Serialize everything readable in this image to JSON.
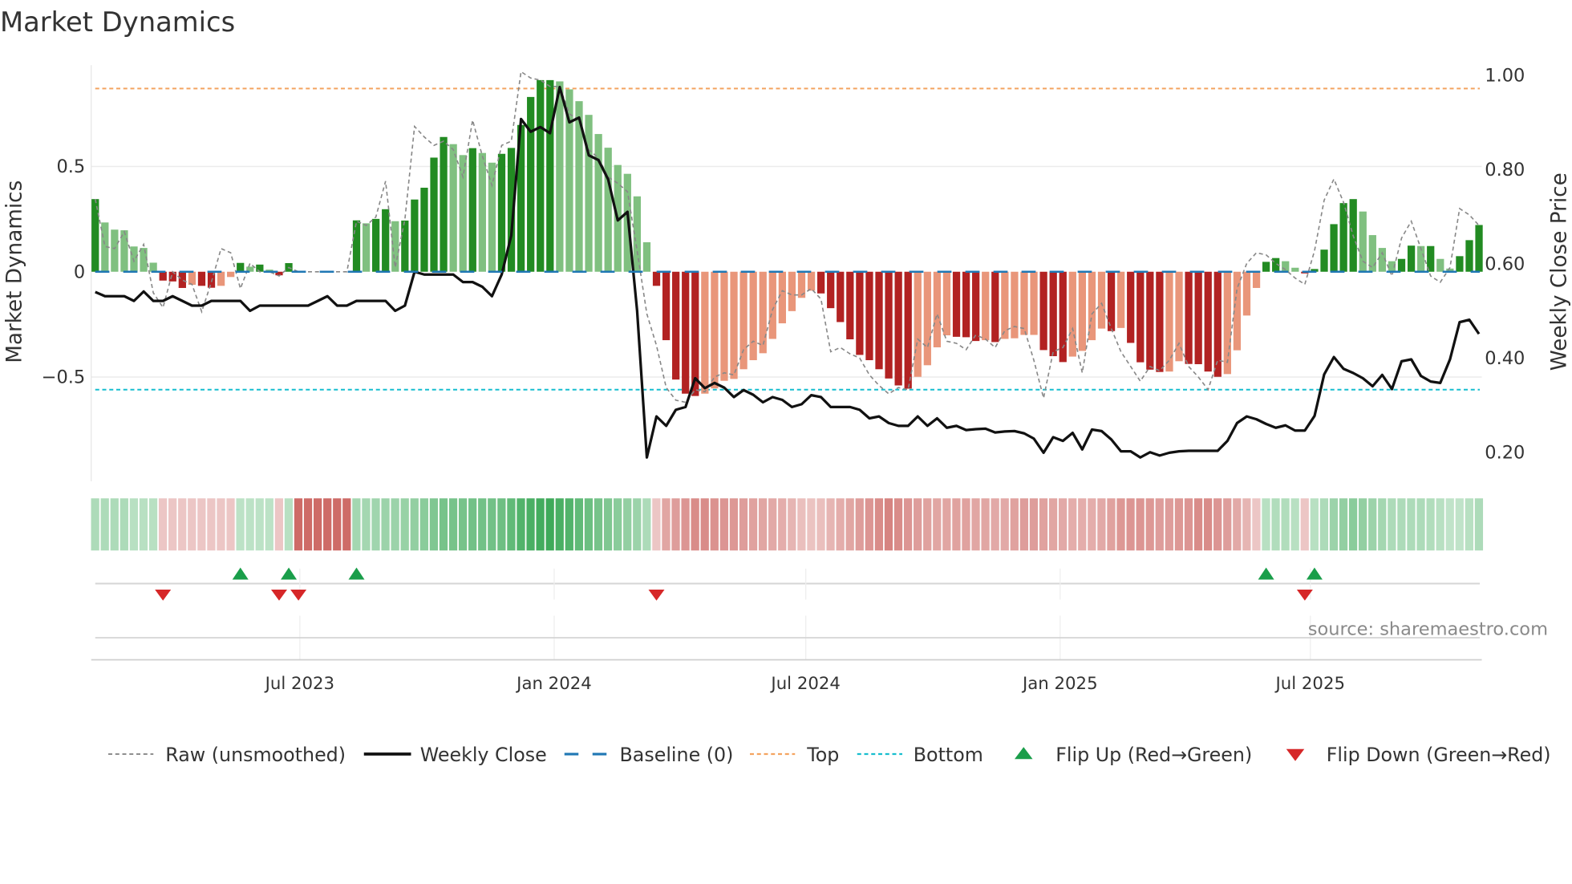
{
  "chart_data": {
    "type": "bar",
    "title": "Market Dynamics",
    "ylabel": "Market Dynamics",
    "y2label": "Weekly Close Price",
    "source": "source: sharemaestro.com",
    "x_start_date": "2023-02-03",
    "x_frequency": "weekly",
    "ylim": [
      -0.98,
      0.98
    ],
    "y2lim": [
      0.17,
      1.02
    ],
    "yticks": [
      {
        "v": 0.5,
        "label": "0.5"
      },
      {
        "v": 0,
        "label": "0"
      },
      {
        "v": -0.5,
        "label": "−0.5"
      }
    ],
    "y2ticks": [
      {
        "v": 1.0,
        "label": "1.00"
      },
      {
        "v": 0.8,
        "label": "0.80"
      },
      {
        "v": 0.6,
        "label": "0.60"
      },
      {
        "v": 0.4,
        "label": "0.40"
      },
      {
        "v": 0.2,
        "label": "0.20"
      }
    ],
    "xticks": [
      {
        "date": "2023-07-01",
        "label": "Jul 2023"
      },
      {
        "date": "2024-01-01",
        "label": "Jan 2024"
      },
      {
        "date": "2024-07-01",
        "label": "Jul 2024"
      },
      {
        "date": "2025-01-01",
        "label": "Jan 2025"
      },
      {
        "date": "2025-07-01",
        "label": "Jul 2025"
      }
    ],
    "reference_lines": {
      "baseline": 0,
      "top": 0.87,
      "bottom": -0.56
    },
    "colors": {
      "green_strong": "#228b22",
      "green_weak": "#80c080",
      "red_strong": "#b22222",
      "red_weak": "#e9967a",
      "close": "#111111",
      "raw": "#888888",
      "baseline": "#1f77b4",
      "top": "#f4a460",
      "bottom": "#17becf",
      "flip_up": "#1a9e4a",
      "flip_down": "#d62728",
      "strip_green": "#27a046",
      "strip_red": "#be3c37"
    },
    "series": [
      {
        "name": "Market Dynamics (smoothed)",
        "type": "bar",
        "values": [
          0.345,
          0.234,
          0.2,
          0.197,
          0.12,
          0.113,
          0.043,
          -0.042,
          -0.046,
          -0.077,
          -0.062,
          -0.067,
          -0.076,
          -0.067,
          -0.025,
          0.042,
          0.024,
          0.034,
          0.01,
          -0.017,
          0.041,
          0,
          0,
          0,
          0,
          0,
          0,
          0.244,
          0.23,
          0.251,
          0.297,
          0.24,
          0.243,
          0.343,
          0.399,
          0.542,
          0.64,
          0.606,
          0.554,
          0.587,
          0.564,
          0.518,
          0.56,
          0.588,
          0.697,
          0.83,
          0.91,
          0.91,
          0.904,
          0.866,
          0.81,
          0.745,
          0.654,
          0.589,
          0.507,
          0.465,
          0.358,
          0.14,
          -0.067,
          -0.325,
          -0.512,
          -0.579,
          -0.59,
          -0.579,
          -0.554,
          -0.518,
          -0.509,
          -0.463,
          -0.42,
          -0.387,
          -0.319,
          -0.245,
          -0.187,
          -0.124,
          -0.09,
          -0.103,
          -0.173,
          -0.239,
          -0.321,
          -0.395,
          -0.42,
          -0.463,
          -0.507,
          -0.54,
          -0.555,
          -0.499,
          -0.444,
          -0.359,
          -0.302,
          -0.309,
          -0.311,
          -0.329,
          -0.325,
          -0.334,
          -0.319,
          -0.316,
          -0.3,
          -0.3,
          -0.372,
          -0.401,
          -0.429,
          -0.403,
          -0.376,
          -0.325,
          -0.27,
          -0.282,
          -0.267,
          -0.338,
          -0.43,
          -0.465,
          -0.476,
          -0.474,
          -0.425,
          -0.438,
          -0.439,
          -0.474,
          -0.499,
          -0.486,
          -0.373,
          -0.208,
          -0.077,
          0.047,
          0.065,
          0.05,
          0.019,
          -0.008,
          0.013,
          0.105,
          0.226,
          0.326,
          0.345,
          0.286,
          0.174,
          0.113,
          0.05,
          0.061,
          0.124,
          0.122,
          0.122,
          0.061,
          0.015,
          0.074,
          0.15,
          0.222
        ],
        "strong": [
          1,
          0,
          0,
          0,
          0,
          0,
          0,
          1,
          1,
          1,
          0,
          1,
          1,
          0,
          0,
          1,
          0,
          1,
          0,
          1,
          1,
          0,
          0,
          0,
          0,
          0,
          0,
          1,
          0,
          1,
          1,
          0,
          1,
          1,
          1,
          1,
          1,
          0,
          0,
          1,
          0,
          0,
          1,
          1,
          1,
          1,
          1,
          1,
          0,
          0,
          0,
          0,
          0,
          0,
          0,
          0,
          0,
          0,
          1,
          1,
          1,
          1,
          1,
          0,
          0,
          0,
          0,
          0,
          0,
          0,
          0,
          0,
          0,
          0,
          0,
          1,
          1,
          1,
          1,
          1,
          1,
          1,
          1,
          1,
          1,
          0,
          0,
          0,
          0,
          1,
          1,
          1,
          0,
          1,
          0,
          0,
          0,
          0,
          1,
          1,
          1,
          0,
          0,
          0,
          0,
          1,
          0,
          1,
          1,
          1,
          1,
          0,
          0,
          1,
          1,
          1,
          1,
          0,
          0,
          0,
          0,
          1,
          1,
          0,
          0,
          1,
          1,
          1,
          1,
          1,
          1,
          0,
          0,
          0,
          0,
          1,
          1,
          0,
          1,
          0,
          0,
          1,
          1,
          1
        ]
      },
      {
        "name": "Raw (unsmoothed)",
        "type": "line",
        "values": [
          0.345,
          0.12,
          0.11,
          0.19,
          0.05,
          0.13,
          -0.1,
          -0.17,
          0,
          -0.04,
          -0.06,
          -0.19,
          -0.05,
          0.11,
          0.09,
          -0.08,
          0.04,
          0,
          0,
          -0.02,
          0.02,
          0,
          0,
          0,
          0,
          0,
          0,
          0.24,
          0.22,
          0.26,
          0.43,
          0.02,
          0.25,
          0.69,
          0.64,
          0.6,
          0.62,
          0.58,
          0.45,
          0.72,
          0.55,
          0.41,
          0.6,
          0.62,
          0.95,
          0.92,
          0.91,
          0.88,
          0.88,
          0.75,
          0.72,
          0.58,
          0.54,
          0.45,
          0.42,
          0.38,
          0.1,
          -0.2,
          -0.35,
          -0.55,
          -0.61,
          -0.62,
          -0.56,
          -0.57,
          -0.5,
          -0.48,
          -0.49,
          -0.37,
          -0.33,
          -0.35,
          -0.18,
          -0.09,
          -0.11,
          -0.11,
          -0.08,
          -0.13,
          -0.38,
          -0.36,
          -0.39,
          -0.41,
          -0.49,
          -0.54,
          -0.58,
          -0.55,
          -0.56,
          -0.32,
          -0.36,
          -0.2,
          -0.33,
          -0.34,
          -0.37,
          -0.3,
          -0.32,
          -0.36,
          -0.28,
          -0.26,
          -0.27,
          -0.42,
          -0.6,
          -0.38,
          -0.36,
          -0.27,
          -0.48,
          -0.2,
          -0.15,
          -0.27,
          -0.38,
          -0.45,
          -0.52,
          -0.45,
          -0.47,
          -0.42,
          -0.34,
          -0.45,
          -0.5,
          -0.56,
          -0.42,
          -0.43,
          -0.08,
          0.04,
          0.09,
          0.08,
          0.04,
          0.01,
          -0.03,
          -0.06,
          0.1,
          0.34,
          0.44,
          0.33,
          0.17,
          0.05,
          0.02,
          0.09,
          -0.02,
          0.16,
          0.24,
          0.11,
          -0.02,
          -0.05,
          0.02,
          0.3,
          0.27,
          0.22
        ]
      },
      {
        "name": "Weekly Close",
        "type": "line",
        "axis": "right",
        "values": [
          0.54,
          0.531,
          0.531,
          0.531,
          0.521,
          0.541,
          0.521,
          0.521,
          0.531,
          0.521,
          0.511,
          0.511,
          0.521,
          0.521,
          0.521,
          0.521,
          0.5,
          0.511,
          0.511,
          0.511,
          0.511,
          0.511,
          0.511,
          0.521,
          0.531,
          0.511,
          0.511,
          0.521,
          0.521,
          0.521,
          0.521,
          0.5,
          0.511,
          0.583,
          0.577,
          0.577,
          0.577,
          0.577,
          0.561,
          0.561,
          0.551,
          0.531,
          0.577,
          0.66,
          0.907,
          0.88,
          0.89,
          0.877,
          0.975,
          0.9,
          0.91,
          0.83,
          0.82,
          0.779,
          0.692,
          0.71,
          0.5,
          0.189,
          0.276,
          0.256,
          0.29,
          0.296,
          0.357,
          0.336,
          0.347,
          0.337,
          0.317,
          0.332,
          0.322,
          0.306,
          0.317,
          0.311,
          0.296,
          0.302,
          0.321,
          0.317,
          0.296,
          0.296,
          0.296,
          0.29,
          0.272,
          0.276,
          0.262,
          0.256,
          0.256,
          0.276,
          0.256,
          0.272,
          0.252,
          0.256,
          0.247,
          0.249,
          0.25,
          0.242,
          0.244,
          0.245,
          0.24,
          0.229,
          0.199,
          0.232,
          0.224,
          0.241,
          0.206,
          0.248,
          0.245,
          0.227,
          0.202,
          0.202,
          0.189,
          0.2,
          0.193,
          0.199,
          0.202,
          0.203,
          0.203,
          0.203,
          0.203,
          0.224,
          0.262,
          0.276,
          0.27,
          0.26,
          0.252,
          0.257,
          0.246,
          0.246,
          0.277,
          0.365,
          0.402,
          0.377,
          0.368,
          0.357,
          0.34,
          0.364,
          0.334,
          0.393,
          0.397,
          0.362,
          0.35,
          0.347,
          0.397,
          0.476,
          0.481,
          0.451
        ]
      }
    ],
    "regime_strip": [
      0.3,
      0.3,
      0.3,
      0.3,
      0.25,
      0.25,
      0.25,
      -0.2,
      -0.2,
      -0.2,
      -0.2,
      -0.2,
      -0.2,
      -0.2,
      -0.2,
      0.22,
      0.22,
      0.22,
      0.22,
      -0.2,
      0.25,
      -0.75,
      -0.75,
      -0.75,
      -0.75,
      -0.75,
      -0.75,
      0.35,
      0.35,
      0.38,
      0.4,
      0.4,
      0.42,
      0.45,
      0.5,
      0.55,
      0.6,
      0.6,
      0.6,
      0.62,
      0.62,
      0.62,
      0.65,
      0.72,
      0.8,
      0.85,
      0.88,
      0.9,
      0.85,
      0.8,
      0.72,
      0.66,
      0.6,
      0.55,
      0.5,
      0.45,
      0.4,
      0.3,
      -0.2,
      -0.4,
      -0.45,
      -0.5,
      -0.55,
      -0.55,
      -0.52,
      -0.5,
      -0.48,
      -0.45,
      -0.42,
      -0.4,
      -0.38,
      -0.35,
      -0.3,
      -0.25,
      -0.22,
      -0.25,
      -0.3,
      -0.35,
      -0.4,
      -0.45,
      -0.5,
      -0.55,
      -0.6,
      -0.55,
      -0.5,
      -0.45,
      -0.42,
      -0.4,
      -0.4,
      -0.42,
      -0.42,
      -0.4,
      -0.4,
      -0.38,
      -0.38,
      -0.42,
      -0.45,
      -0.45,
      -0.42,
      -0.4,
      -0.38,
      -0.35,
      -0.35,
      -0.35,
      -0.38,
      -0.42,
      -0.48,
      -0.5,
      -0.5,
      -0.48,
      -0.45,
      -0.45,
      -0.48,
      -0.5,
      -0.55,
      -0.55,
      -0.5,
      -0.45,
      -0.38,
      -0.3,
      -0.2,
      0.25,
      0.28,
      0.28,
      0.25,
      -0.2,
      0.25,
      0.3,
      0.4,
      0.45,
      0.5,
      0.45,
      0.4,
      0.35,
      0.3,
      0.3,
      0.3,
      0.3,
      0.28,
      0.25,
      0.2,
      0.2,
      0.25,
      0.3
    ],
    "flip_up_weeks": [
      16,
      21,
      28,
      122,
      127
    ],
    "flip_down_weeks": [
      8,
      20,
      22,
      59,
      126
    ],
    "legend": {
      "placement": "bottom",
      "items": [
        "Raw (unsmoothed)",
        "Weekly Close",
        "Baseline (0)",
        "Top",
        "Bottom",
        "Flip Up (Red→Green)",
        "Flip Down (Green→Red)"
      ]
    }
  }
}
